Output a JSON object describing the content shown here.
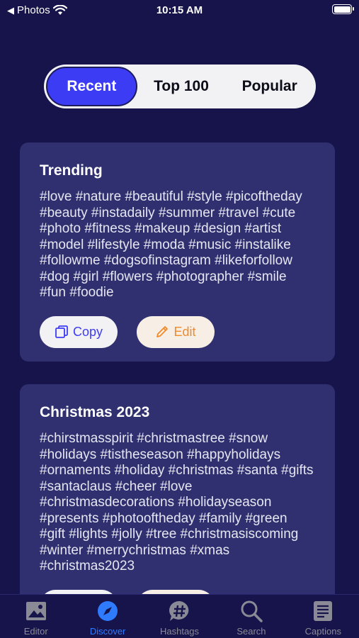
{
  "status": {
    "back_app": "Photos",
    "time": "10:15 AM"
  },
  "segments": [
    {
      "label": "Recent",
      "active": true
    },
    {
      "label": "Top 100",
      "active": false
    },
    {
      "label": "Popular",
      "active": false
    }
  ],
  "cards": [
    {
      "title": "Trending",
      "tags": "#love #nature #beautiful #style #picoftheday #beauty #instadaily #summer #travel #cute #photo #fitness #makeup #design #artist #model #lifestyle #moda #music #instalike #followme #dogsofinstagram #likeforfollow #dog #girl #flowers #photographer #smile #fun #foodie",
      "copy_label": "Copy",
      "edit_label": "Edit"
    },
    {
      "title": "Christmas 2023",
      "tags": "#chirstmasspirit #christmastree #snow #holidays #tistheseason #happyholidays #ornaments #holiday #christmas #santa #gifts #santaclaus #cheer #love #christmasdecorations #holidayseason #presents #photooftheday #family #green #gift #lights #jolly #tree #christmasiscoming #winter #merrychristmas #xmas #christmas2023"
    }
  ],
  "tabs": [
    {
      "label": "Editor",
      "icon": "photo-icon",
      "active": false
    },
    {
      "label": "Discover",
      "icon": "compass-icon",
      "active": true
    },
    {
      "label": "Hashtags",
      "icon": "hashtag-bubble-icon",
      "active": false
    },
    {
      "label": "Search",
      "icon": "magnifier-icon",
      "active": false
    },
    {
      "label": "Captions",
      "icon": "document-icon",
      "active": false
    }
  ],
  "colors": {
    "background": "#16144a",
    "card": "#303070",
    "accent": "#3d3cf5",
    "tab_active": "#2f7bff",
    "edit": "#f08a2a"
  }
}
